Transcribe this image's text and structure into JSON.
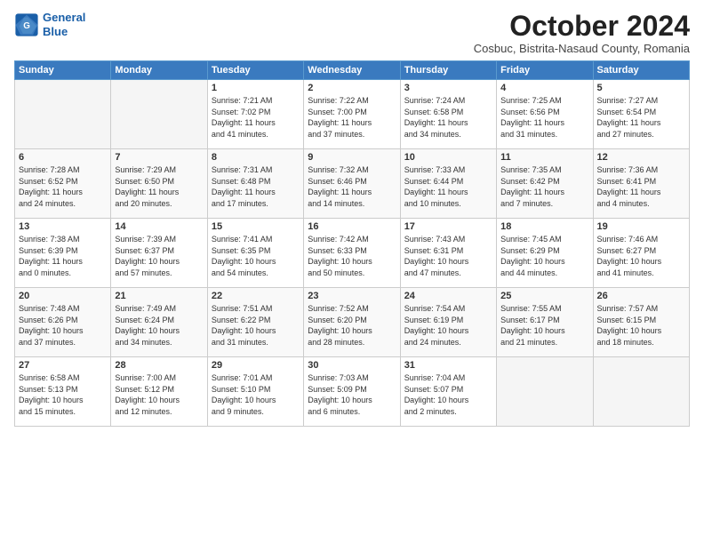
{
  "logo": {
    "line1": "General",
    "line2": "Blue"
  },
  "title": "October 2024",
  "subtitle": "Cosbuc, Bistrita-Nasaud County, Romania",
  "weekdays": [
    "Sunday",
    "Monday",
    "Tuesday",
    "Wednesday",
    "Thursday",
    "Friday",
    "Saturday"
  ],
  "weeks": [
    [
      {
        "day": "",
        "info": ""
      },
      {
        "day": "",
        "info": ""
      },
      {
        "day": "1",
        "info": "Sunrise: 7:21 AM\nSunset: 7:02 PM\nDaylight: 11 hours\nand 41 minutes."
      },
      {
        "day": "2",
        "info": "Sunrise: 7:22 AM\nSunset: 7:00 PM\nDaylight: 11 hours\nand 37 minutes."
      },
      {
        "day": "3",
        "info": "Sunrise: 7:24 AM\nSunset: 6:58 PM\nDaylight: 11 hours\nand 34 minutes."
      },
      {
        "day": "4",
        "info": "Sunrise: 7:25 AM\nSunset: 6:56 PM\nDaylight: 11 hours\nand 31 minutes."
      },
      {
        "day": "5",
        "info": "Sunrise: 7:27 AM\nSunset: 6:54 PM\nDaylight: 11 hours\nand 27 minutes."
      }
    ],
    [
      {
        "day": "6",
        "info": "Sunrise: 7:28 AM\nSunset: 6:52 PM\nDaylight: 11 hours\nand 24 minutes."
      },
      {
        "day": "7",
        "info": "Sunrise: 7:29 AM\nSunset: 6:50 PM\nDaylight: 11 hours\nand 20 minutes."
      },
      {
        "day": "8",
        "info": "Sunrise: 7:31 AM\nSunset: 6:48 PM\nDaylight: 11 hours\nand 17 minutes."
      },
      {
        "day": "9",
        "info": "Sunrise: 7:32 AM\nSunset: 6:46 PM\nDaylight: 11 hours\nand 14 minutes."
      },
      {
        "day": "10",
        "info": "Sunrise: 7:33 AM\nSunset: 6:44 PM\nDaylight: 11 hours\nand 10 minutes."
      },
      {
        "day": "11",
        "info": "Sunrise: 7:35 AM\nSunset: 6:42 PM\nDaylight: 11 hours\nand 7 minutes."
      },
      {
        "day": "12",
        "info": "Sunrise: 7:36 AM\nSunset: 6:41 PM\nDaylight: 11 hours\nand 4 minutes."
      }
    ],
    [
      {
        "day": "13",
        "info": "Sunrise: 7:38 AM\nSunset: 6:39 PM\nDaylight: 11 hours\nand 0 minutes."
      },
      {
        "day": "14",
        "info": "Sunrise: 7:39 AM\nSunset: 6:37 PM\nDaylight: 10 hours\nand 57 minutes."
      },
      {
        "day": "15",
        "info": "Sunrise: 7:41 AM\nSunset: 6:35 PM\nDaylight: 10 hours\nand 54 minutes."
      },
      {
        "day": "16",
        "info": "Sunrise: 7:42 AM\nSunset: 6:33 PM\nDaylight: 10 hours\nand 50 minutes."
      },
      {
        "day": "17",
        "info": "Sunrise: 7:43 AM\nSunset: 6:31 PM\nDaylight: 10 hours\nand 47 minutes."
      },
      {
        "day": "18",
        "info": "Sunrise: 7:45 AM\nSunset: 6:29 PM\nDaylight: 10 hours\nand 44 minutes."
      },
      {
        "day": "19",
        "info": "Sunrise: 7:46 AM\nSunset: 6:27 PM\nDaylight: 10 hours\nand 41 minutes."
      }
    ],
    [
      {
        "day": "20",
        "info": "Sunrise: 7:48 AM\nSunset: 6:26 PM\nDaylight: 10 hours\nand 37 minutes."
      },
      {
        "day": "21",
        "info": "Sunrise: 7:49 AM\nSunset: 6:24 PM\nDaylight: 10 hours\nand 34 minutes."
      },
      {
        "day": "22",
        "info": "Sunrise: 7:51 AM\nSunset: 6:22 PM\nDaylight: 10 hours\nand 31 minutes."
      },
      {
        "day": "23",
        "info": "Sunrise: 7:52 AM\nSunset: 6:20 PM\nDaylight: 10 hours\nand 28 minutes."
      },
      {
        "day": "24",
        "info": "Sunrise: 7:54 AM\nSunset: 6:19 PM\nDaylight: 10 hours\nand 24 minutes."
      },
      {
        "day": "25",
        "info": "Sunrise: 7:55 AM\nSunset: 6:17 PM\nDaylight: 10 hours\nand 21 minutes."
      },
      {
        "day": "26",
        "info": "Sunrise: 7:57 AM\nSunset: 6:15 PM\nDaylight: 10 hours\nand 18 minutes."
      }
    ],
    [
      {
        "day": "27",
        "info": "Sunrise: 6:58 AM\nSunset: 5:13 PM\nDaylight: 10 hours\nand 15 minutes."
      },
      {
        "day": "28",
        "info": "Sunrise: 7:00 AM\nSunset: 5:12 PM\nDaylight: 10 hours\nand 12 minutes."
      },
      {
        "day": "29",
        "info": "Sunrise: 7:01 AM\nSunset: 5:10 PM\nDaylight: 10 hours\nand 9 minutes."
      },
      {
        "day": "30",
        "info": "Sunrise: 7:03 AM\nSunset: 5:09 PM\nDaylight: 10 hours\nand 6 minutes."
      },
      {
        "day": "31",
        "info": "Sunrise: 7:04 AM\nSunset: 5:07 PM\nDaylight: 10 hours\nand 2 minutes."
      },
      {
        "day": "",
        "info": ""
      },
      {
        "day": "",
        "info": ""
      }
    ]
  ]
}
